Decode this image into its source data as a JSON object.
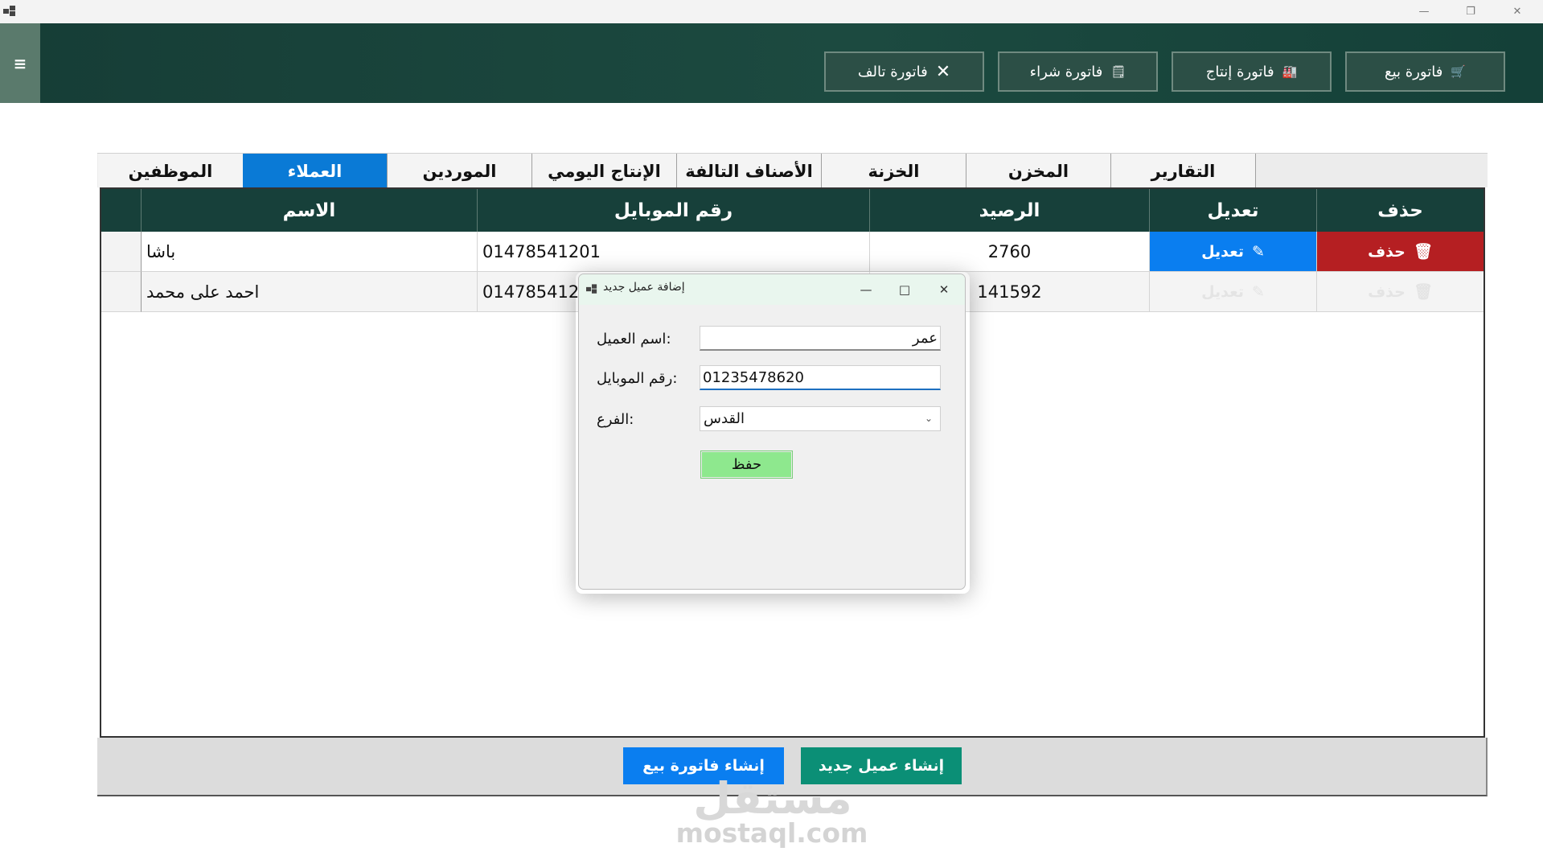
{
  "header": {
    "buttons": [
      {
        "label": "فاتورة بيع",
        "icon": "cart-icon"
      },
      {
        "label": "فاتورة إنتاج",
        "icon": "factory-icon"
      },
      {
        "label": "فاتورة شراء",
        "icon": "receipt-icon"
      },
      {
        "label": "فاتورة تالف",
        "icon": "x-icon"
      }
    ]
  },
  "tabs": [
    "التقارير",
    "المخزن",
    "الخزنة",
    "الأصناف التالفة",
    "الإنتاج اليومي",
    "الموردين",
    "العملاء",
    "الموظفين"
  ],
  "active_tab": "العملاء",
  "grid": {
    "columns": {
      "name": "الاسم",
      "mobile": "رقم الموبايل",
      "balance": "الرصيد",
      "edit": "تعديل",
      "delete": "حذف"
    },
    "rows": [
      {
        "name": "باشا",
        "mobile": "01478541201",
        "balance": "2760",
        "edit_label": "تعديل",
        "delete_label": "حذف"
      },
      {
        "name": "احمد على محمد",
        "mobile": "014785412",
        "balance": "141592",
        "edit_label": "تعديل",
        "delete_label": "حذف"
      }
    ]
  },
  "bottom": {
    "new_invoice": "إنشاء فاتورة بيع",
    "new_customer": "إنشاء عميل جديد"
  },
  "dialog": {
    "title": "إضافة عميل جديد",
    "name_label": "اسم العميل:",
    "name_value": "عمر",
    "mobile_label": "رقم الموبايل:",
    "mobile_value": "01235478620",
    "branch_label": "الفرع:",
    "branch_value": "القدس",
    "save_label": "حفظ"
  },
  "watermark": {
    "logo": "مستقل",
    "text": "mostaql.com"
  },
  "colors": {
    "header_bg": "#1c4a40",
    "active_tab": "#0a7ad6",
    "edit_blue": "#0a7ef0",
    "delete_red": "#b51f22",
    "save_green": "#8ee88e"
  }
}
